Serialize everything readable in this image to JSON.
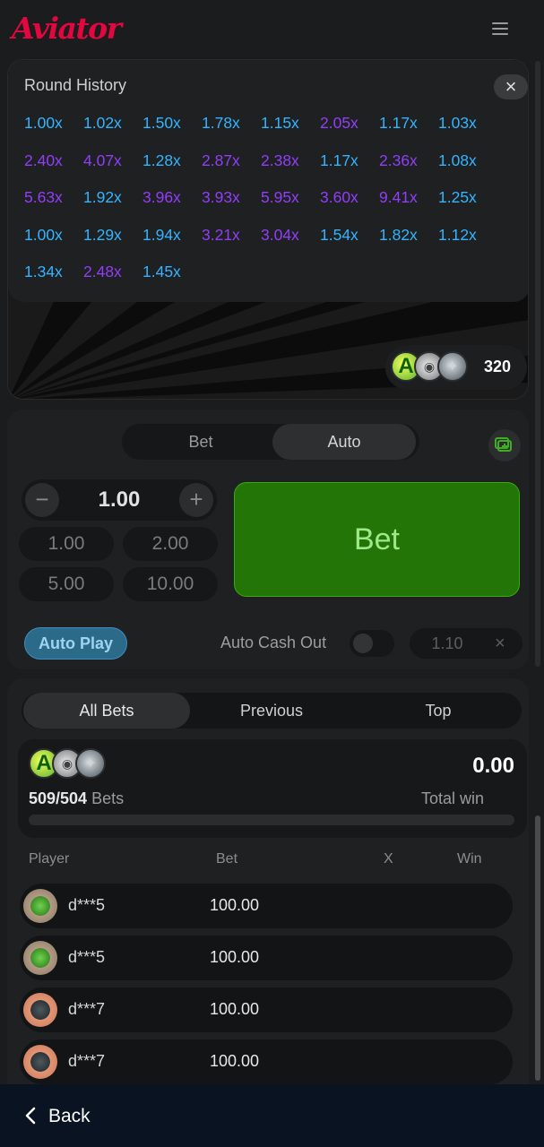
{
  "header": {
    "logo": "Aviator",
    "menu_icon": "hamburger-menu-icon"
  },
  "round_history": {
    "title": "Round History",
    "close_icon": "close-icon",
    "rows": [
      [
        {
          "v": "1.00x",
          "c": "blue"
        },
        {
          "v": "1.02x",
          "c": "blue"
        },
        {
          "v": "1.50x",
          "c": "blue"
        },
        {
          "v": "1.78x",
          "c": "blue"
        },
        {
          "v": "1.15x",
          "c": "blue"
        },
        {
          "v": "2.05x",
          "c": "purple"
        },
        {
          "v": "1.17x",
          "c": "blue"
        },
        {
          "v": "1.03x",
          "c": "blue"
        }
      ],
      [
        {
          "v": "2.40x",
          "c": "purple"
        },
        {
          "v": "4.07x",
          "c": "purple"
        },
        {
          "v": "1.28x",
          "c": "blue"
        },
        {
          "v": "2.87x",
          "c": "purple"
        },
        {
          "v": "2.38x",
          "c": "purple"
        },
        {
          "v": "1.17x",
          "c": "blue"
        },
        {
          "v": "2.36x",
          "c": "purple"
        },
        {
          "v": "1.08x",
          "c": "blue"
        }
      ],
      [
        {
          "v": "5.63x",
          "c": "purple"
        },
        {
          "v": "1.92x",
          "c": "blue"
        },
        {
          "v": "3.96x",
          "c": "purple"
        },
        {
          "v": "3.93x",
          "c": "purple"
        },
        {
          "v": "5.95x",
          "c": "purple"
        },
        {
          "v": "3.60x",
          "c": "purple"
        },
        {
          "v": "9.41x",
          "c": "purple"
        },
        {
          "v": "1.25x",
          "c": "blue"
        }
      ],
      [
        {
          "v": "1.00x",
          "c": "blue"
        },
        {
          "v": "1.29x",
          "c": "blue"
        },
        {
          "v": "1.94x",
          "c": "blue"
        },
        {
          "v": "3.21x",
          "c": "purple"
        },
        {
          "v": "3.04x",
          "c": "purple"
        },
        {
          "v": "1.54x",
          "c": "blue"
        },
        {
          "v": "1.82x",
          "c": "blue"
        },
        {
          "v": "1.12x",
          "c": "blue"
        }
      ],
      [
        {
          "v": "1.34x",
          "c": "blue"
        },
        {
          "v": "2.48x",
          "c": "purple"
        },
        {
          "v": "1.45x",
          "c": "blue"
        }
      ]
    ]
  },
  "online": {
    "count": "320"
  },
  "bet_panel": {
    "tabs": [
      "Bet",
      "Auto"
    ],
    "active_tab": "Auto",
    "amount": "1.00",
    "minus": "−",
    "plus": "+",
    "quick_amounts": [
      "1.00",
      "2.00",
      "5.00",
      "10.00"
    ],
    "bet_button": "Bet",
    "auto_play": "Auto Play",
    "auto_cash_out_label": "Auto Cash Out",
    "auto_cash_out_value": "1.10",
    "clear": "×"
  },
  "bets_list": {
    "tabs": [
      "All Bets",
      "Previous",
      "Top"
    ],
    "active_tab": "All Bets",
    "bets_count": "509/504",
    "bets_word": "Bets",
    "total_win_value": "0.00",
    "total_win_label": "Total win",
    "columns": [
      "Player",
      "Bet",
      "X",
      "Win"
    ],
    "rows": [
      {
        "player": "d***5",
        "bet": "100.00",
        "avatar": "clover"
      },
      {
        "player": "d***5",
        "bet": "100.00",
        "avatar": "clover"
      },
      {
        "player": "d***7",
        "bet": "100.00",
        "avatar": "robot"
      },
      {
        "player": "d***7",
        "bet": "100.00",
        "avatar": "robot"
      }
    ]
  },
  "footer": {
    "back_label": "Back"
  },
  "colors": {
    "brand": "#e4073f",
    "mult_blue": "#34b4ff",
    "mult_purple": "#913ef8",
    "bet_green": "#247507",
    "footer_bg": "#091321"
  }
}
